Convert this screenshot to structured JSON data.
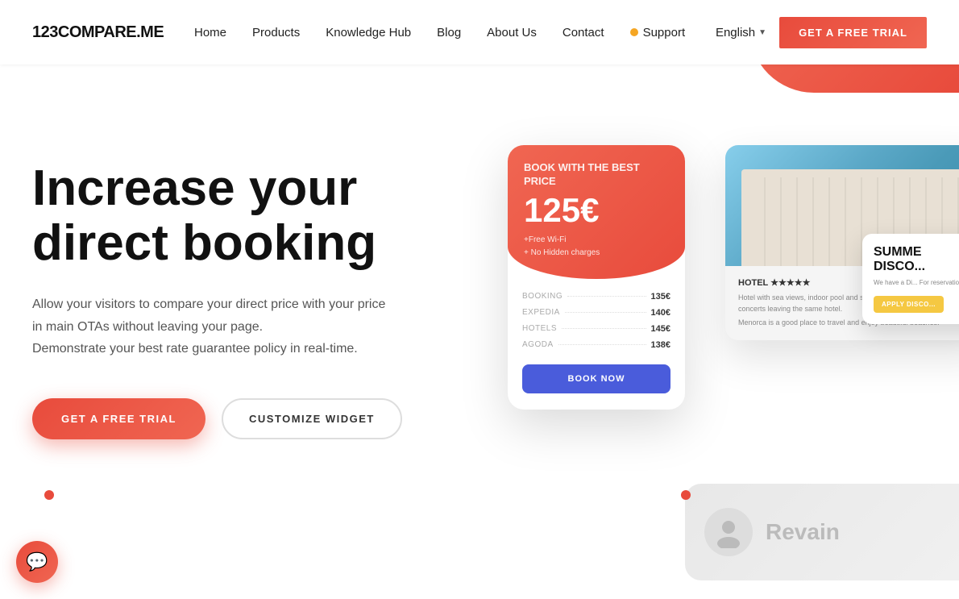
{
  "brand": {
    "logo": "123COMPARE.ME"
  },
  "navbar": {
    "links": [
      {
        "id": "home",
        "label": "Home"
      },
      {
        "id": "products",
        "label": "Products"
      },
      {
        "id": "knowledge-hub",
        "label": "Knowledge Hub"
      },
      {
        "id": "blog",
        "label": "Blog"
      },
      {
        "id": "about-us",
        "label": "About Us"
      },
      {
        "id": "contact",
        "label": "Contact"
      }
    ],
    "support_label": "Support",
    "language": "English",
    "cta_label": "GET A FREE TRIAL"
  },
  "hero": {
    "title_line1": "Increase your",
    "title_line2": "direct booking",
    "description_line1": "Allow your visitors to compare your direct price with your price",
    "description_line2": "in main OTAs without leaving your page.",
    "description_line3": "Demonstrate your best rate guarantee policy in real-time.",
    "btn_primary": "GET A FREE TRIAL",
    "btn_secondary": "CUSTOMIZE WIDGET"
  },
  "booking_card": {
    "header_title": "BOOK WITH THE BEST PRICE",
    "price": "125€",
    "perk1": "+Free Wi-Fi",
    "perk2": "+ No Hidden charges",
    "rows": [
      {
        "label": "BOOKING",
        "amount": "135€"
      },
      {
        "label": "EXPEDIA",
        "amount": "140€"
      },
      {
        "label": "HOTELS",
        "amount": "145€"
      },
      {
        "label": "AGODA",
        "amount": "138€"
      }
    ],
    "book_btn": "BOOK NOW"
  },
  "hotel_card": {
    "stars": "HOTEL ★★★★★",
    "body_text1": "Hotel with sea views, indoor pool and sports service, you can enjoy concerts leaving the same hotel.",
    "body_text2": "Menorca is a good place to travel and enjoy beautiful beaches."
  },
  "summer_popup": {
    "title": "SUMME DISCO...",
    "desc": "We have a Di... For reservatio...",
    "btn": "APPLY DISCO..."
  },
  "revain": {
    "brand": "Revain"
  },
  "chat": {
    "icon": "💬"
  }
}
